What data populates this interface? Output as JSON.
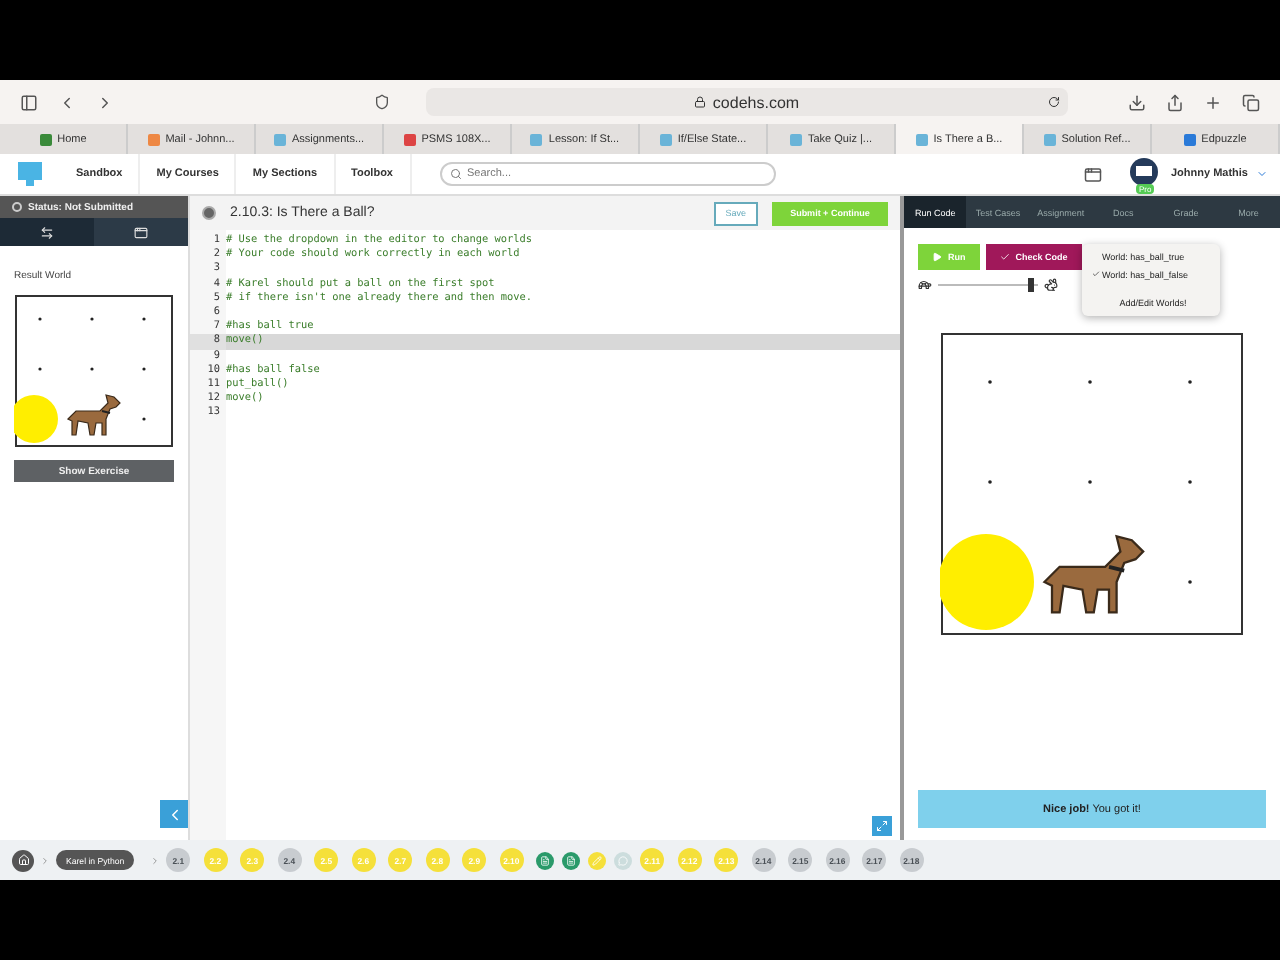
{
  "browser": {
    "url": "codehs.com"
  },
  "tabs": [
    {
      "label": "Home",
      "selected": false
    },
    {
      "label": "Mail - Johnn...",
      "selected": false
    },
    {
      "label": "Assignments...",
      "selected": false
    },
    {
      "label": "PSMS 108X...",
      "selected": false
    },
    {
      "label": "Lesson: If St...",
      "selected": false
    },
    {
      "label": "If/Else State...",
      "selected": false
    },
    {
      "label": "Take Quiz |...",
      "selected": false
    },
    {
      "label": "Is There a B...",
      "selected": true
    },
    {
      "label": "Solution Ref...",
      "selected": false
    },
    {
      "label": "Edpuzzle",
      "selected": false
    }
  ],
  "nav": {
    "links": [
      "Sandbox",
      "My Courses",
      "My Sections",
      "Toolbox"
    ],
    "search": {
      "placeholder": "Search..."
    },
    "user": "Johnny Mathis",
    "badge": "Pro"
  },
  "sidebar": {
    "status": "Status: Not Submitted",
    "tabs": [
      {
        "selected": true
      },
      {
        "selected": false
      }
    ],
    "result_label": "Result World",
    "button": "Show Exercise"
  },
  "editor": {
    "title": "2.10.3: Is There a Ball?",
    "save": "Save",
    "submit": "Submit + Continue",
    "lines": [
      {
        "n": "1",
        "text": "# Use the dropdown in the editor to change worlds",
        "selected": false
      },
      {
        "n": "2",
        "text": "# Your code should work correctly in each world",
        "selected": false
      },
      {
        "n": "3",
        "selected": false
      },
      {
        "n": "4",
        "text": "# Karel should put a ball on the first spot",
        "selected": false
      },
      {
        "n": "5",
        "text": "# if there isn't one already there and then move.",
        "selected": false
      },
      {
        "n": "6",
        "selected": false
      },
      {
        "n": "7",
        "text": "#has ball true",
        "selected": false
      },
      {
        "n": "8",
        "text": "move()",
        "selected": true
      },
      {
        "n": "9",
        "selected": false
      },
      {
        "n": "10",
        "text": "#has ball false",
        "selected": false
      },
      {
        "n": "11",
        "text": "put_ball()",
        "selected": false
      },
      {
        "n": "12",
        "text": "move()",
        "selected": false
      },
      {
        "n": "13",
        "selected": false
      }
    ]
  },
  "right_panel": {
    "tabs": [
      {
        "label": "Run Code",
        "selected": true
      },
      {
        "label": "Test Cases",
        "selected": false
      },
      {
        "label": "Assignment",
        "selected": false
      },
      {
        "label": "Docs",
        "selected": false
      },
      {
        "label": "Grade",
        "selected": false
      },
      {
        "label": "More",
        "selected": false
      }
    ],
    "run": "Run",
    "check": "Check Code",
    "speed": {
      "level": 0.92
    },
    "world_menu": {
      "items": [
        {
          "label": "World: has_ball_true",
          "checked": false
        },
        {
          "label": "World: has_ball_false",
          "checked": true
        }
      ],
      "add": "Add/Edit Worlds!"
    },
    "message_bold": "Nice job!",
    "message": "You got it!"
  },
  "progress": {
    "course": "Karel in Python",
    "items": [
      {
        "kind": "num",
        "label": "2.1",
        "done": false
      },
      {
        "kind": "num",
        "label": "2.2",
        "done": true
      },
      {
        "kind": "num",
        "label": "2.3",
        "done": true
      },
      {
        "kind": "num",
        "label": "2.4",
        "done": false
      },
      {
        "kind": "num",
        "label": "2.5",
        "done": true
      },
      {
        "kind": "num",
        "label": "2.6",
        "done": true
      },
      {
        "kind": "num",
        "label": "2.7",
        "done": true
      },
      {
        "kind": "num",
        "label": "2.8",
        "done": true
      },
      {
        "kind": "num",
        "label": "2.9",
        "done": true
      },
      {
        "kind": "num",
        "label": "2.10",
        "done": true
      },
      {
        "kind": "doc",
        "done": true
      },
      {
        "kind": "doc",
        "done": true
      },
      {
        "kind": "pencil",
        "done": true
      },
      {
        "kind": "chat",
        "done": false
      },
      {
        "kind": "num",
        "label": "2.11",
        "done": true
      },
      {
        "kind": "num",
        "label": "2.12",
        "done": true
      },
      {
        "kind": "num",
        "label": "2.13",
        "done": true
      },
      {
        "kind": "num",
        "label": "2.14",
        "done": false
      },
      {
        "kind": "num",
        "label": "2.15",
        "done": false
      },
      {
        "kind": "num",
        "label": "2.16",
        "done": false
      },
      {
        "kind": "num",
        "label": "2.17",
        "done": false
      },
      {
        "kind": "num",
        "label": "2.18",
        "done": false
      }
    ]
  }
}
